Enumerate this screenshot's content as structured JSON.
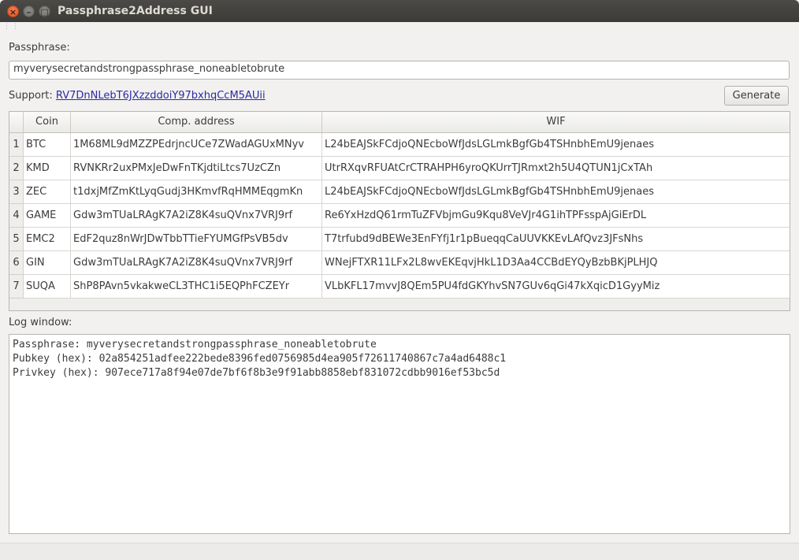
{
  "window": {
    "title": "Passphrase2Address GUI",
    "close_glyph": "×",
    "min_glyph": "–",
    "max_glyph": "□"
  },
  "passphrase": {
    "label": "Passphrase:",
    "value": "myverysecretandstrongpassphrase_noneabletobrute"
  },
  "support": {
    "label": "Support:",
    "link": "RV7DnNLebT6JXzzddoiY97bxhqCcM5AUii"
  },
  "generate_label": "Generate",
  "table": {
    "headers": [
      "Coin",
      "Comp. address",
      "WIF"
    ],
    "rows": [
      {
        "num": "1",
        "coin": "BTC",
        "address": "1M68ML9dMZZPEdrjncUCe7ZWadAGUxMNyv",
        "wif": "L24bEAJSkFCdjoQNEcboWfJdsLGLmkBgfGb4TSHnbhEmU9jenaes"
      },
      {
        "num": "2",
        "coin": "KMD",
        "address": "RVNKRr2uxPMxJeDwFnTKjdtiLtcs7UzCZn",
        "wif": "UtrRXqvRFUAtCrCTRAHPH6yroQKUrrTJRmxt2h5U4QTUN1jCxTAh"
      },
      {
        "num": "3",
        "coin": "ZEC",
        "address": "t1dxjMfZmKtLyqGudj3HKmvfRqHMMEqgmKn",
        "wif": "L24bEAJSkFCdjoQNEcboWfJdsLGLmkBgfGb4TSHnbhEmU9jenaes"
      },
      {
        "num": "4",
        "coin": "GAME",
        "address": "Gdw3mTUaLRAgK7A2iZ8K4suQVnx7VRJ9rf",
        "wif": "Re6YxHzdQ61rmTuZFVbjmGu9Kqu8VeVJr4G1ihTPFsspAjGiErDL"
      },
      {
        "num": "5",
        "coin": "EMC2",
        "address": "EdF2quz8nWrJDwTbbTTieFYUMGfPsVB5dv",
        "wif": "T7trfubd9dBEWe3EnFYfj1r1pBueqqCaUUVKKEvLAfQvz3JFsNhs"
      },
      {
        "num": "6",
        "coin": "GIN",
        "address": "Gdw3mTUaLRAgK7A2iZ8K4suQVnx7VRJ9rf",
        "wif": "WNejFTXR11LFx2L8wvEKEqvjHkL1D3Aa4CCBdEYQyBzbBKjPLHJQ"
      },
      {
        "num": "7",
        "coin": "SUQA",
        "address": "ShP8PAvn5vkakweCL3THC1i5EQPhFCZEYr",
        "wif": "VLbKFL17mvvJ8QEm5PU4fdGKYhvSN7GUv6qGi47kXqicD1GyyMiz"
      }
    ]
  },
  "log": {
    "label": "Log window:",
    "lines": [
      "Passphrase: myverysecretandstrongpassphrase_noneabletobrute",
      "Pubkey (hex): 02a854251adfee222bede8396fed0756985d4ea905f72611740867c7a4ad6488c1",
      "Privkey (hex): 907ece717a8f94e07de7bf6f8b3e9f91abb8858ebf831072cdbb9016ef53bc5d"
    ]
  }
}
